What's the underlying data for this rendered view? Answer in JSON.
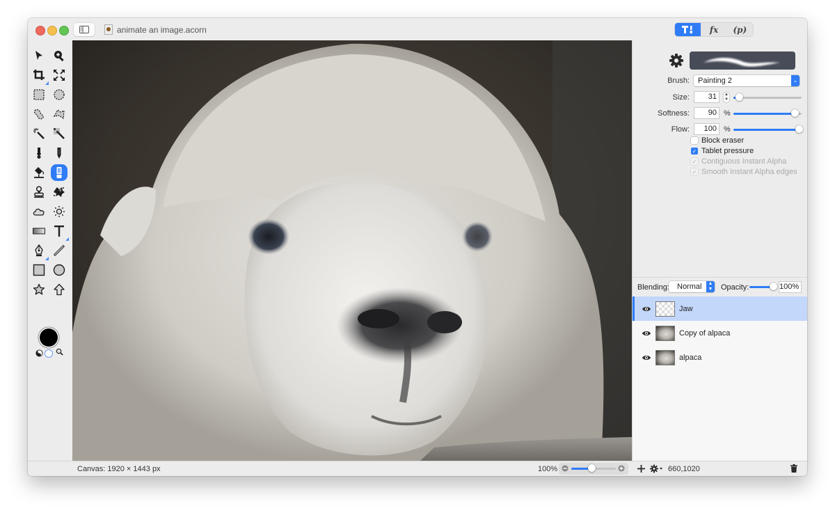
{
  "window": {
    "title": "animate an image.acorn"
  },
  "toolbar": {
    "inspector_tabs": [
      {
        "label": "T¦",
        "icon": "tools-icon",
        "active": true
      },
      {
        "label": "fx",
        "icon": "effects-icon",
        "active": false
      },
      {
        "label": "(p)",
        "icon": "plugins-icon",
        "active": false
      }
    ]
  },
  "tools": [
    {
      "name": "select-arrow-tool",
      "icon": "arrow-pointer-icon"
    },
    {
      "name": "zoom-tool",
      "icon": "magnifier-plus-icon"
    },
    {
      "name": "crop-tool",
      "icon": "crop-icon"
    },
    {
      "name": "transform-tool",
      "icon": "expand-arrows-icon"
    },
    {
      "name": "rect-select-tool",
      "icon": "dashed-rect-icon"
    },
    {
      "name": "ellipse-select-tool",
      "icon": "dashed-circle-icon"
    },
    {
      "name": "lasso-tool",
      "icon": "lasso-icon"
    },
    {
      "name": "polygon-lasso-tool",
      "icon": "polygon-lasso-icon"
    },
    {
      "name": "magic-wand-tool",
      "icon": "magic-wand-icon"
    },
    {
      "name": "instant-alpha-tool",
      "icon": "instant-alpha-icon"
    },
    {
      "name": "brush-tool",
      "icon": "brush-icon"
    },
    {
      "name": "pencil-tool",
      "icon": "pencil-icon"
    },
    {
      "name": "paint-bucket-tool",
      "icon": "paint-bucket-icon"
    },
    {
      "name": "eraser-tool",
      "icon": "eraser-icon",
      "active": true
    },
    {
      "name": "clone-stamp-tool",
      "icon": "stamp-icon"
    },
    {
      "name": "smudge-tool",
      "icon": "splatter-icon"
    },
    {
      "name": "burn-tool",
      "icon": "cloud-icon"
    },
    {
      "name": "dodge-tool",
      "icon": "sun-icon"
    },
    {
      "name": "gradient-tool",
      "icon": "gradient-icon"
    },
    {
      "name": "text-tool",
      "icon": "text-t-icon"
    },
    {
      "name": "bezier-pen-tool",
      "icon": "pen-nib-icon"
    },
    {
      "name": "line-tool",
      "icon": "line-icon"
    },
    {
      "name": "rectangle-shape-tool",
      "icon": "square-icon"
    },
    {
      "name": "oval-shape-tool",
      "icon": "circle-icon"
    },
    {
      "name": "star-shape-tool",
      "icon": "star-icon"
    },
    {
      "name": "arrow-shape-tool",
      "icon": "up-arrow-icon"
    }
  ],
  "colors": {
    "foreground": "#000000",
    "background": "#ffffff",
    "accent": "#2f7cf6",
    "selected_layer": "#c3d7fb"
  },
  "inspector": {
    "brush_label": "Brush:",
    "brush_value": "Painting 2",
    "size_label": "Size:",
    "size_value": "31",
    "size_fraction": 0.08,
    "softness_label": "Softness:",
    "softness_value": "90",
    "softness_fraction": 0.9,
    "flow_label": "Flow:",
    "flow_value": "100",
    "flow_fraction": 1.0,
    "percent_sign": "%",
    "checkboxes": [
      {
        "label": "Block eraser",
        "checked": false,
        "enabled": true
      },
      {
        "label": "Tablet pressure",
        "checked": true,
        "enabled": true
      },
      {
        "label": "Contiguous Instant Alpha",
        "checked": true,
        "enabled": false
      },
      {
        "label": "Smooth Instant Alpha edges",
        "checked": true,
        "enabled": false
      }
    ]
  },
  "layers_bar": {
    "blending_label": "Blending:",
    "blending_value": "Normal",
    "opacity_label": "Opacity:",
    "opacity_value": "100%",
    "opacity_fraction": 1.0
  },
  "layers": [
    {
      "name": "Jaw",
      "visible": true,
      "selected": true,
      "thumbnail": "transparent"
    },
    {
      "name": "Copy of alpaca",
      "visible": true,
      "selected": false,
      "thumbnail": "alpaca"
    },
    {
      "name": "alpaca",
      "visible": true,
      "selected": false,
      "thumbnail": "alpaca"
    }
  ],
  "status": {
    "canvas_size": "Canvas: 1920 × 1443 px",
    "zoom_level": "100%",
    "zoom_fraction": 0.45,
    "coordinates": "660,1020"
  }
}
